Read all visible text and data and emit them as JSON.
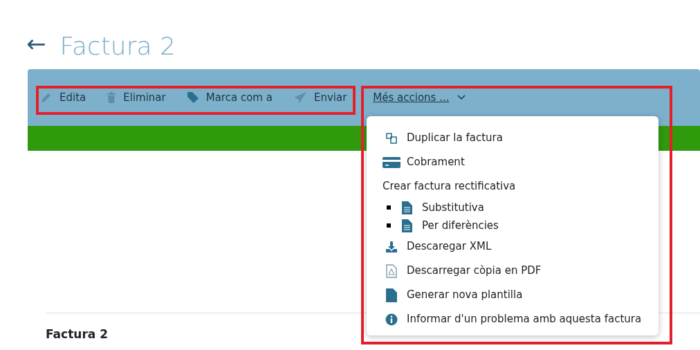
{
  "header": {
    "back": "←",
    "title": "Factura 2"
  },
  "toolbar": [
    {
      "label": "Edita"
    },
    {
      "label": "Eliminar"
    },
    {
      "label": "Marca com a"
    },
    {
      "label": "Enviar"
    }
  ],
  "more_actions": {
    "label": "Més accions ...",
    "expanded": true
  },
  "menu": [
    {
      "kind": "item",
      "label": "Duplicar la factura"
    },
    {
      "kind": "item",
      "label": "Cobrament"
    },
    {
      "kind": "heading",
      "label": "Crear factura rectificativa"
    },
    {
      "kind": "subitem",
      "label": "Substitutiva"
    },
    {
      "kind": "subitem",
      "label": "Per diferències"
    },
    {
      "kind": "item",
      "label": "Descaregar XML"
    },
    {
      "kind": "item",
      "label": "Descarregar còpia en PDF"
    },
    {
      "kind": "item",
      "label": "Generar nova plantilla"
    },
    {
      "kind": "item",
      "label": "Informar d'un problema amb aquesta factura"
    }
  ],
  "section_title": "Factura 2",
  "highlights": {
    "toolbar": true,
    "more_actions": true
  }
}
